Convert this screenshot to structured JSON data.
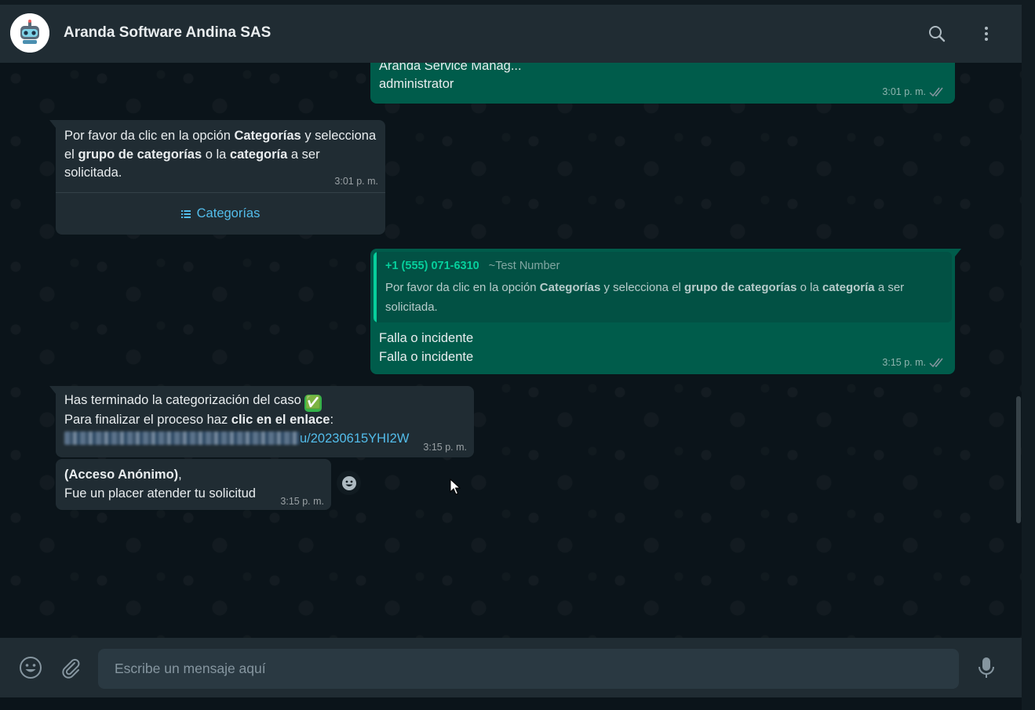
{
  "header": {
    "title": "Aranda Software Andina SAS",
    "search_icon": "search-icon",
    "menu_icon": "kebab-menu-icon"
  },
  "messages": {
    "m1": {
      "line1": "Aranda Service Manag...",
      "line2": "administrator",
      "time": "3:01 p. m."
    },
    "m2": {
      "t1": "Por favor da clic en la opción ",
      "b1": "Categorías",
      "t2": " y selecciona el ",
      "b2": "grupo de categorías",
      "t3": " o la ",
      "b3": "categoría",
      "t4": " a ser solicitada.",
      "time": "3:01 p. m.",
      "button_label": "Categorías"
    },
    "m3": {
      "quote_sender": "+1 (555) 071-6310",
      "quote_name": "~Test Number",
      "q1": "Por favor da clic en la opción ",
      "qb1": "Categorías",
      "q2": " y selecciona el ",
      "qb2": "grupo de categorías",
      "q3": " o la ",
      "qb3": "categoría",
      "q4": " a ser solicitada.",
      "line1": "Falla o incidente",
      "line2": "Falla o incidente",
      "time": "3:15 p. m."
    },
    "m4": {
      "t1": "Has terminado la categorización del caso ",
      "emoji": "✅",
      "t2": "Para finalizar el proceso haz ",
      "b1": "clic en el enlace",
      "t3": ":",
      "link_tail": "u/20230615YHI2W",
      "time": "3:15 p. m."
    },
    "m5": {
      "b1": "(Acceso Anónimo)",
      "t1": ",",
      "t2": "Fue un placer atender tu solicitud",
      "time": "3:15 p. m."
    }
  },
  "footer": {
    "placeholder": "Escribe un mensaje aquí",
    "emoji_icon": "emoji-icon",
    "attach_icon": "attach-icon",
    "mic_icon": "mic-icon"
  },
  "colors": {
    "incoming_bubble": "#202c33",
    "outgoing_bubble": "#005c4b",
    "accent": "#53bdeb",
    "quote_accent": "#06cf9c"
  }
}
